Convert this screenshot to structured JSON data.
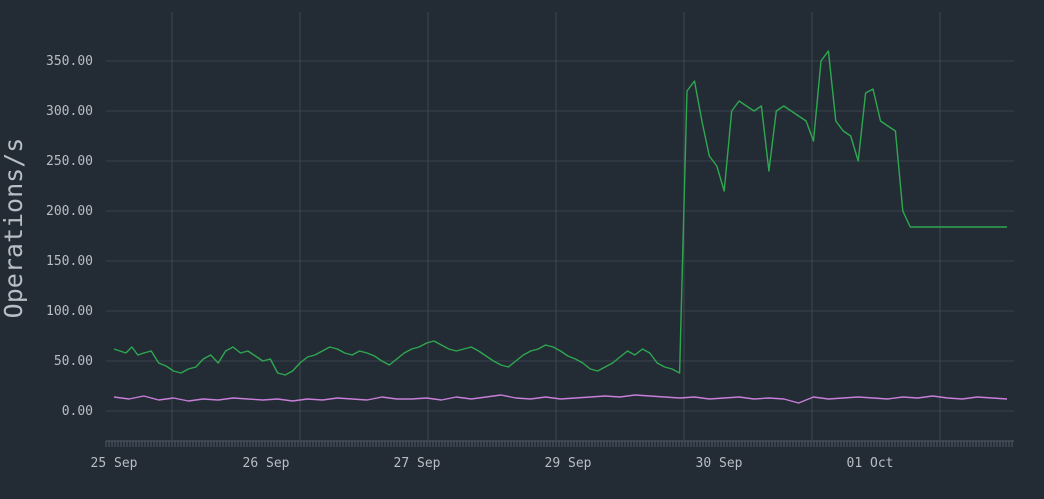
{
  "chart_data": {
    "type": "line",
    "title": "",
    "xlabel": "",
    "ylabel": "Operations/s",
    "ylim": [
      -30,
      390
    ],
    "yticks": [
      "0.00",
      "50.00",
      "100.00",
      "150.00",
      "200.00",
      "250.00",
      "300.00",
      "350.00"
    ],
    "ytick_values": [
      0,
      50,
      100,
      150,
      200,
      250,
      300,
      350
    ],
    "grid": true,
    "legend": "none",
    "x_range": [
      0,
      6
    ],
    "xticks": [
      "25 Sep",
      "26 Sep",
      "27 Sep",
      "29 Sep",
      "30 Sep",
      "01 Oct"
    ],
    "xtick_values": [
      0,
      1,
      2,
      3,
      4,
      5
    ],
    "series": [
      {
        "color": "#2ea84f",
        "x": [
          0.0,
          0.04,
          0.08,
          0.12,
          0.16,
          0.2,
          0.25,
          0.3,
          0.35,
          0.4,
          0.45,
          0.5,
          0.55,
          0.6,
          0.65,
          0.7,
          0.75,
          0.8,
          0.85,
          0.9,
          0.95,
          1.0,
          1.05,
          1.1,
          1.15,
          1.2,
          1.25,
          1.3,
          1.35,
          1.4,
          1.45,
          1.5,
          1.55,
          1.6,
          1.65,
          1.7,
          1.75,
          1.8,
          1.85,
          1.9,
          1.95,
          2.0,
          2.05,
          2.1,
          2.15,
          2.2,
          2.25,
          2.3,
          2.35,
          2.4,
          2.45,
          2.5,
          2.55,
          2.6,
          2.65,
          2.7,
          2.75,
          2.8,
          2.85,
          2.9,
          2.95,
          3.0,
          3.05,
          3.1,
          3.15,
          3.2,
          3.25,
          3.3,
          3.35,
          3.4,
          3.45,
          3.5,
          3.55,
          3.6,
          3.65,
          3.7,
          3.75,
          3.8,
          3.85,
          3.9,
          3.95,
          4.0,
          4.05,
          4.1,
          4.15,
          4.2,
          4.25,
          4.3,
          4.35,
          4.4,
          4.45,
          4.5,
          4.55,
          4.6,
          4.65,
          4.7,
          4.75,
          4.8,
          4.85,
          4.9,
          4.95,
          5.0,
          5.05,
          5.1,
          5.15,
          5.2,
          5.25,
          5.3,
          5.35,
          5.4,
          5.45,
          5.5,
          5.55,
          5.6,
          5.65,
          5.7,
          5.75,
          5.8,
          5.85,
          5.9,
          5.95,
          6.0
        ],
        "values": [
          62,
          60,
          58,
          64,
          56,
          58,
          60,
          48,
          45,
          40,
          38,
          42,
          44,
          52,
          56,
          48,
          60,
          64,
          58,
          60,
          55,
          50,
          52,
          38,
          36,
          40,
          48,
          54,
          56,
          60,
          64,
          62,
          58,
          56,
          60,
          58,
          55,
          50,
          46,
          52,
          58,
          62,
          64,
          68,
          70,
          66,
          62,
          60,
          62,
          64,
          60,
          55,
          50,
          46,
          44,
          50,
          56,
          60,
          62,
          66,
          64,
          60,
          55,
          52,
          48,
          42,
          40,
          44,
          48,
          54,
          60,
          56,
          62,
          58,
          48,
          44,
          42,
          38,
          320,
          330,
          290,
          255,
          245,
          220,
          300,
          310,
          305,
          300,
          305,
          240,
          300,
          305,
          300,
          295,
          290,
          270,
          350,
          360,
          290,
          280,
          275,
          250,
          318,
          322,
          290,
          285,
          280,
          200,
          184,
          184,
          184,
          184,
          184,
          184,
          184,
          184,
          184,
          184,
          184,
          184,
          184,
          184
        ]
      },
      {
        "color": "#c77fd8",
        "x": [
          0.0,
          0.1,
          0.2,
          0.3,
          0.4,
          0.5,
          0.6,
          0.7,
          0.8,
          0.9,
          1.0,
          1.1,
          1.2,
          1.3,
          1.4,
          1.5,
          1.6,
          1.7,
          1.8,
          1.9,
          2.0,
          2.1,
          2.2,
          2.3,
          2.4,
          2.5,
          2.6,
          2.7,
          2.8,
          2.9,
          3.0,
          3.1,
          3.2,
          3.3,
          3.4,
          3.5,
          3.6,
          3.7,
          3.8,
          3.9,
          4.0,
          4.1,
          4.2,
          4.3,
          4.4,
          4.5,
          4.6,
          4.7,
          4.8,
          4.9,
          5.0,
          5.1,
          5.2,
          5.3,
          5.4,
          5.5,
          5.6,
          5.7,
          5.8,
          5.9,
          6.0
        ],
        "values": [
          14,
          12,
          15,
          11,
          13,
          10,
          12,
          11,
          13,
          12,
          11,
          12,
          10,
          12,
          11,
          13,
          12,
          11,
          14,
          12,
          12,
          13,
          11,
          14,
          12,
          14,
          16,
          13,
          12,
          14,
          12,
          13,
          14,
          15,
          14,
          16,
          15,
          14,
          13,
          14,
          12,
          13,
          14,
          12,
          13,
          12,
          8,
          14,
          12,
          13,
          14,
          13,
          12,
          14,
          13,
          15,
          13,
          12,
          14,
          13,
          12
        ]
      }
    ]
  }
}
